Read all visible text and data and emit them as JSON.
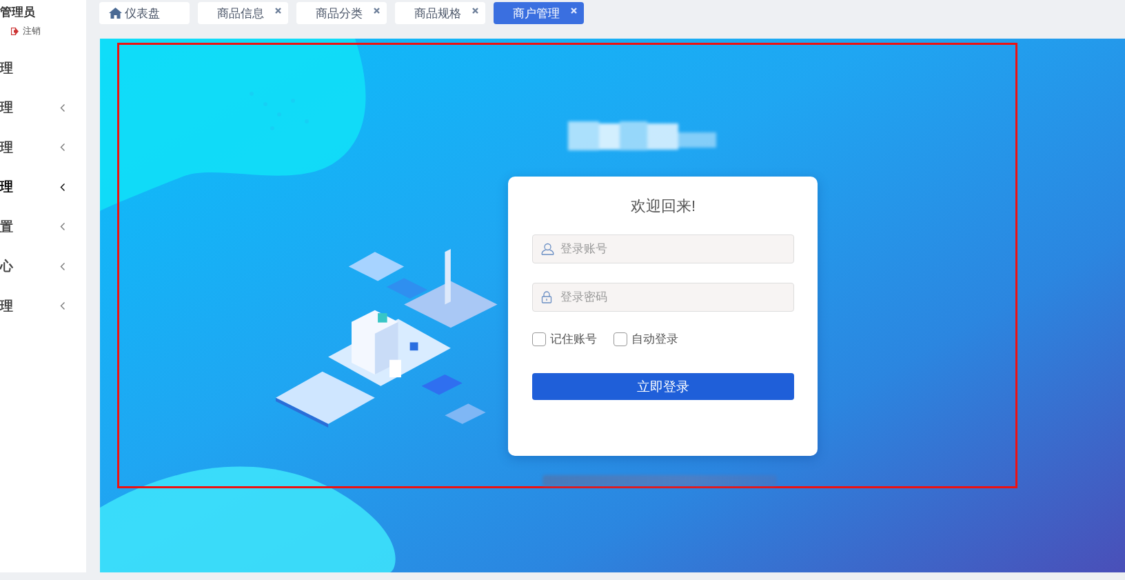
{
  "sidebar": {
    "user": "管理员",
    "logout": "注销",
    "items": [
      {
        "label": "理",
        "kind": "link",
        "selected": false
      },
      {
        "label": "理",
        "kind": "group",
        "expanded": false,
        "selected": false
      },
      {
        "label": "理",
        "kind": "group",
        "expanded": false,
        "selected": false
      },
      {
        "label": "理",
        "kind": "group",
        "expanded": false,
        "selected": true
      },
      {
        "label": "置",
        "kind": "group",
        "expanded": false,
        "selected": false
      },
      {
        "label": "心",
        "kind": "group",
        "expanded": false,
        "selected": false
      },
      {
        "label": "理",
        "kind": "group",
        "expanded": false,
        "selected": false
      }
    ]
  },
  "tabs": [
    {
      "label": "仪表盘",
      "kind": "home",
      "selected": false
    },
    {
      "label": "商品信息",
      "kind": "page",
      "selected": false
    },
    {
      "label": "商品分类",
      "kind": "page",
      "selected": false
    },
    {
      "label": "商品规格",
      "kind": "page",
      "selected": false
    },
    {
      "label": "商户管理",
      "kind": "page",
      "selected": true
    }
  ],
  "login": {
    "redacted_title": true,
    "heading": "欢迎回来!",
    "fields": [
      {
        "kind": "user",
        "placeholder": "登录账号"
      },
      {
        "kind": "password",
        "placeholder": "登录密码"
      }
    ],
    "options": [
      {
        "label": "记住账号",
        "checked": false
      },
      {
        "label": "自动登录",
        "checked": false
      }
    ],
    "submit": "立即登录",
    "redacted_footer": true
  }
}
